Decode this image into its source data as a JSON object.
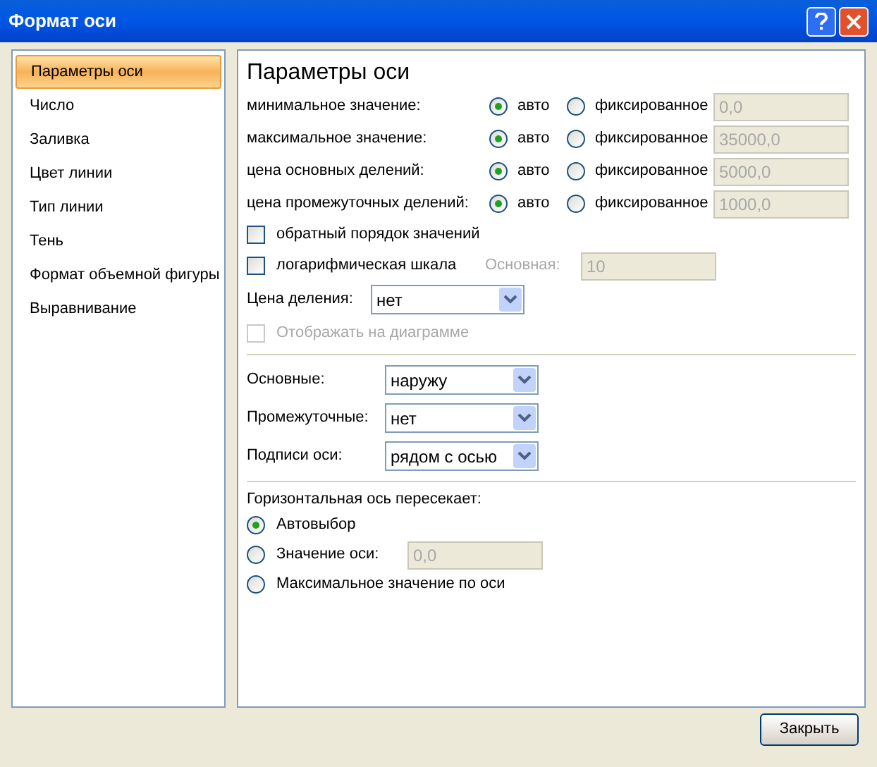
{
  "window": {
    "title": "Формат оси"
  },
  "sidebar": {
    "items": [
      {
        "label": "Параметры оси",
        "selected": true
      },
      {
        "label": "Число",
        "selected": false
      },
      {
        "label": "Заливка",
        "selected": false
      },
      {
        "label": "Цвет линии",
        "selected": false
      },
      {
        "label": "Тип линии",
        "selected": false
      },
      {
        "label": "Тень",
        "selected": false
      },
      {
        "label": "Формат объемной фигуры",
        "selected": false
      },
      {
        "label": "Выравнивание",
        "selected": false
      }
    ]
  },
  "panel": {
    "title": "Параметры оси",
    "bounds": [
      {
        "label": "минимальное значение:",
        "options": [
          {
            "label": "авто",
            "selected": true
          },
          {
            "label": "фиксированное",
            "selected": false
          }
        ],
        "value": "0,0",
        "disabled": true
      },
      {
        "label": "максимальное значение:",
        "options": [
          {
            "label": "авто",
            "selected": true
          },
          {
            "label": "фиксированное",
            "selected": false
          }
        ],
        "value": "35000,0",
        "disabled": true
      },
      {
        "label": "цена основных делений:",
        "options": [
          {
            "label": "авто",
            "selected": true
          },
          {
            "label": "фиксированное",
            "selected": false
          }
        ],
        "value": "5000,0",
        "disabled": true
      },
      {
        "label": "цена промежуточных делений:",
        "options": [
          {
            "label": "авто",
            "selected": true
          },
          {
            "label": "фиксированное",
            "selected": false
          }
        ],
        "value": "1000,0",
        "disabled": true
      }
    ],
    "reverse_order": {
      "label": "обратный порядок значений",
      "checked": false
    },
    "log_scale": {
      "label": "логарифмическая шкала",
      "checked": false,
      "base_label": "Основная:",
      "base_value": "10",
      "disabled": true
    },
    "display_units": {
      "label": "Цена деления:",
      "value": "нет"
    },
    "show_on_chart": {
      "label": "Отображать на диаграмме",
      "checked": false,
      "disabled": true
    },
    "tick_marks": [
      {
        "label": "Основные:",
        "value": "наружу"
      },
      {
        "label": "Промежуточные:",
        "value": "нет"
      },
      {
        "label": "Подписи оси:",
        "value": "рядом с осью"
      }
    ],
    "crosses": {
      "label": "Горизонтальная ось пересекает:",
      "options": [
        {
          "label": "Автовыбор",
          "selected": true
        },
        {
          "label": "Значение оси:",
          "selected": false,
          "value": "0,0"
        },
        {
          "label": "Максимальное значение по оси",
          "selected": false
        }
      ]
    }
  },
  "buttons": [
    {
      "label": "Закрыть"
    }
  ]
}
